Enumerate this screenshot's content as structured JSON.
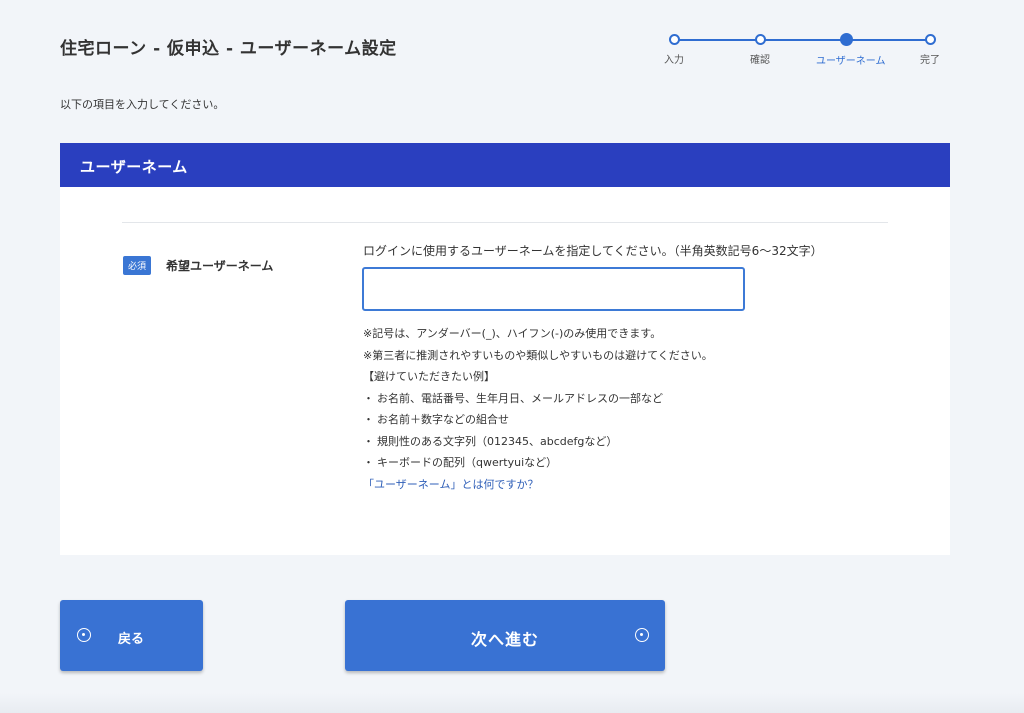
{
  "page": {
    "title": "住宅ローン - 仮申込 - ユーザーネーム設定",
    "intro": "以下の項目を入力してください。"
  },
  "stepper": {
    "steps": [
      {
        "label": "入力",
        "state": "done"
      },
      {
        "label": "確認",
        "state": "done"
      },
      {
        "label": "ユーザーネーム",
        "state": "current"
      },
      {
        "label": "完了",
        "state": "todo"
      }
    ],
    "accent_color": "#2f6dd1"
  },
  "card": {
    "header": "ユーザーネーム",
    "header_color": "#2a3fbf",
    "field": {
      "required_badge": "必須",
      "label": "希望ユーザーネーム",
      "instruction": "ログインに使用するユーザーネームを指定してください。（半角英数記号6〜32文字）",
      "value": "",
      "placeholder": ""
    },
    "notes": {
      "line1": "※記号は、アンダーバー(_)、ハイフン(-)のみ使用できます。",
      "line2": "※第三者に推測されやすいものや類似しやすいものは避けてください。",
      "examples_title": "【避けていただきたい例】",
      "bullet_mark": "・",
      "examples": [
        "お名前、電話番号、生年月日、メールアドレスの一部など",
        "お名前＋数字などの組合せ",
        "規則性のある文字列（012345、abcdefgなど）",
        "キーボードの配列（qwertyuiなど）"
      ],
      "help_link": "「ユーザーネーム」とは何ですか？"
    }
  },
  "buttons": {
    "back": {
      "label": "戻る",
      "icon": "circle-dot-icon"
    },
    "next": {
      "label": "次へ進む",
      "icon": "circle-dot-icon"
    },
    "color": "#3972d3"
  }
}
